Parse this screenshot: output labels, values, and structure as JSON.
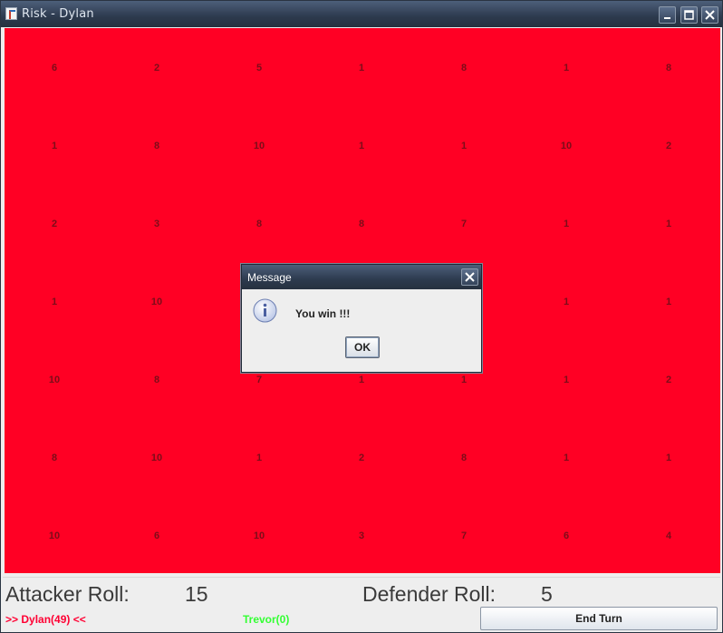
{
  "window": {
    "title": "Risk - Dylan"
  },
  "board": {
    "color": "#ff0024",
    "rows": [
      [
        "6",
        "2",
        "5",
        "1",
        "8",
        "1",
        "8"
      ],
      [
        "1",
        "8",
        "10",
        "1",
        "1",
        "10",
        "2"
      ],
      [
        "2",
        "3",
        "8",
        "8",
        "7",
        "1",
        "1"
      ],
      [
        "1",
        "10",
        "",
        "",
        "",
        "1",
        "1"
      ],
      [
        "10",
        "8",
        "7",
        "1",
        "1",
        "1",
        "2"
      ],
      [
        "8",
        "10",
        "1",
        "2",
        "8",
        "1",
        "1"
      ],
      [
        "10",
        "6",
        "10",
        "3",
        "7",
        "6",
        "4"
      ]
    ]
  },
  "status": {
    "attacker_label": "Attacker Roll:",
    "attacker_value": "15",
    "defender_label": "Defender Roll:",
    "defender_value": "5",
    "current_player": ">> Dylan(49) <<",
    "current_player_color": "#ff0033",
    "other_player": "Trevor(0)",
    "other_player_color": "#33ff33",
    "end_turn_label": "End Turn"
  },
  "dialog": {
    "title": "Message",
    "message": "You win !!!",
    "ok_label": "OK",
    "icon": "info-icon"
  }
}
